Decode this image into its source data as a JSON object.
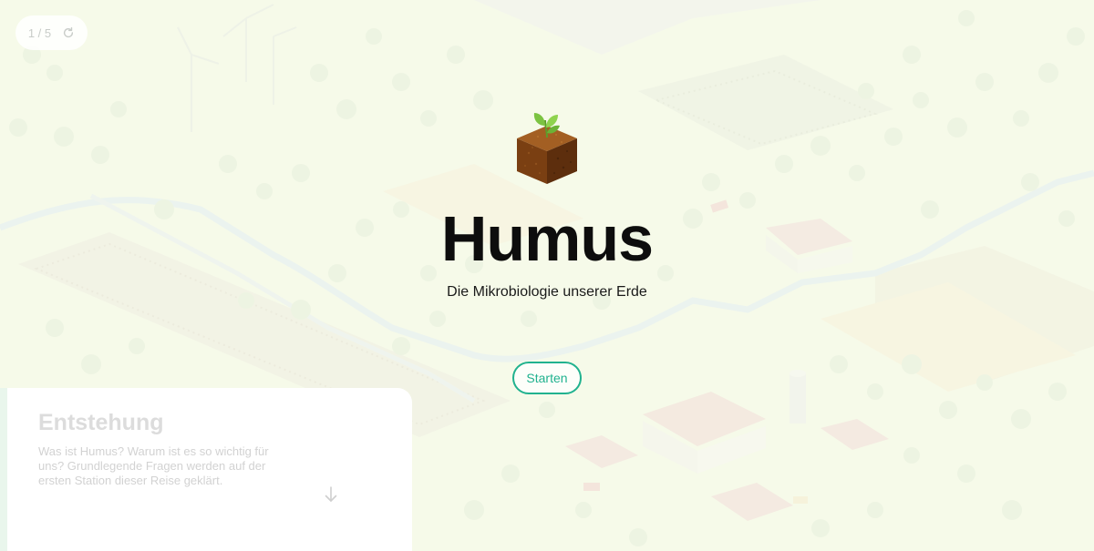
{
  "progress": {
    "text": "1 / 5",
    "reload_icon": "reload-icon"
  },
  "hero": {
    "logo_icon": "soil-cube-sprout-icon",
    "title": "Humus",
    "subtitle": "Die Mikrobiologie unserer Erde",
    "start_label": "Starten"
  },
  "chapter_card": {
    "title": "Entstehung",
    "text": "Was ist Humus? Warum ist es so wichtig für uns? Grundlegende Fragen werden auf der ersten Station dieser Reise geklärt.",
    "arrow_icon": "arrow-down-icon"
  },
  "colors": {
    "accent": "#21b28f",
    "background": "#f6faea",
    "title": "#0d0d0d"
  }
}
